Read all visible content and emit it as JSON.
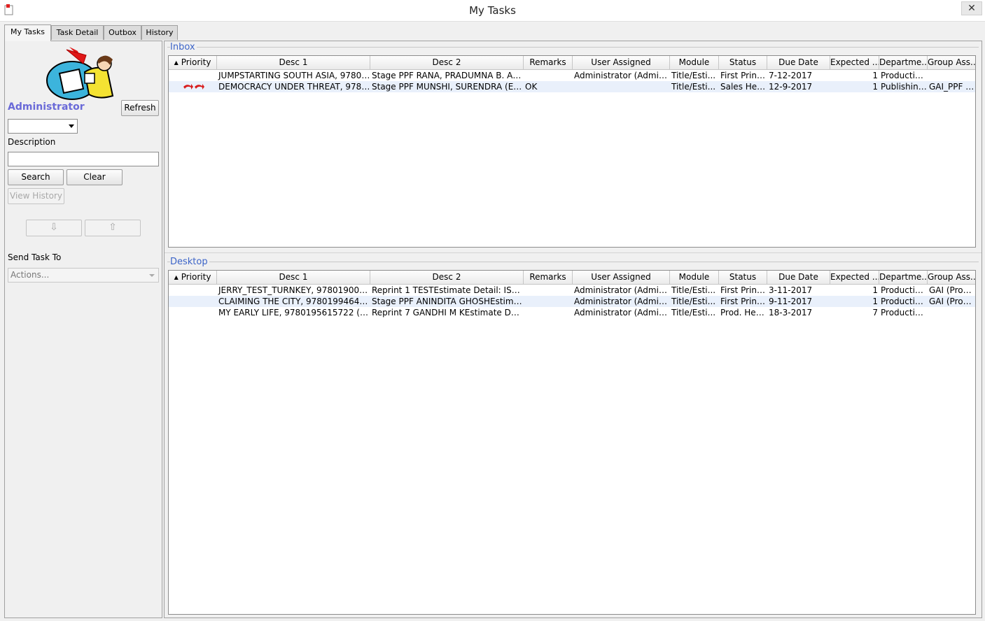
{
  "window": {
    "title": "My Tasks",
    "close_glyph": "✕"
  },
  "tabs": [
    {
      "label": "My Tasks",
      "active": true
    },
    {
      "label": "Task Detail"
    },
    {
      "label": "Outbox"
    },
    {
      "label": "History"
    }
  ],
  "left": {
    "user_label": "Administrator",
    "refresh_label": "Refresh",
    "description_label": "Description",
    "description_value": "",
    "search_label": "Search",
    "clear_label": "Clear",
    "view_history_label": "View History",
    "down_glyph": "⇩",
    "up_glyph": "⇧",
    "send_task_label": "Send Task To",
    "actions_value": "Actions..."
  },
  "columns": [
    "Priority",
    "Desc 1",
    "Desc 2",
    "Remarks",
    "User Assigned",
    "Module",
    "Status",
    "Due Date",
    "Expected ...",
    "Departme...",
    "Group Ass..."
  ],
  "inbox": {
    "title": "Inbox",
    "rows": [
      {
        "priority": "",
        "desc1": "JUMPSTARTING SOUTH ASIA, 97801...",
        "desc2": "Stage PPF RANA, PRADUMNA B. AN...",
        "remarks": "",
        "user": "Administrator (Admini...",
        "module": "Title/Esti...",
        "status": "First Print ...",
        "due": "7-12-2017",
        "expected": "1",
        "dept": "Productio...",
        "group": ""
      },
      {
        "priority": "high",
        "desc1": "DEMOCRACY UNDER THREAT, 9780...",
        "desc2": "Stage PPF MUNSHI, SURENDRA (ED....",
        "remarks": "OK",
        "user": "",
        "module": "Title/Esti...",
        "status": "Sales Hea...",
        "due": "12-9-2017",
        "expected": "1",
        "dept": "Publishing...",
        "group": "GAI_PPF (..."
      }
    ]
  },
  "desktop": {
    "title": "Desktop",
    "rows": [
      {
        "priority": "",
        "desc1": "JERRY_TEST_TURNKEY, 9780190010...",
        "desc2": "Reprint 1 TESTEstimate Detail: ISBN: ...",
        "remarks": "",
        "user": "Administrator (Admini...",
        "module": "Title/Esti...",
        "status": "First Print ...",
        "due": "3-11-2017",
        "expected": "1",
        "dept": "Productio...",
        "group": "GAI (Prod...."
      },
      {
        "priority": "",
        "desc1": "CLAIMING THE CITY, 978019946479...",
        "desc2": "Stage PPF ANINDITA GHOSHEstimat...",
        "remarks": "",
        "user": "Administrator (Admini...",
        "module": "Title/Esti...",
        "status": "First Print ...",
        "due": "9-11-2017",
        "expected": "1",
        "dept": "Productio...",
        "group": "GAI (Prod...."
      },
      {
        "priority": "",
        "desc1": "MY EARLY LIFE, 9780195615722 (01...",
        "desc2": "Reprint 7 GANDHI  M KEstimate Det...",
        "remarks": "",
        "user": "Administrator (Admini...",
        "module": "Title/Esti...",
        "status": "Prod. Hea...",
        "due": "18-3-2017",
        "expected": "7",
        "dept": "Productio...",
        "group": ""
      }
    ]
  },
  "colors": {
    "accent": "#3c64c8",
    "user_label": "#6a6ad8",
    "row_alt": "#e9f0fb",
    "priority_arrow": "#d81c1c"
  }
}
